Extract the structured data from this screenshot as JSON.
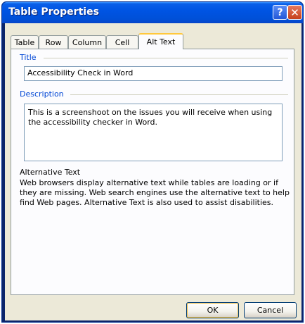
{
  "window": {
    "title": "Table Properties"
  },
  "titlebar": {
    "help_glyph": "?",
    "close_glyph": "✕"
  },
  "tabs": [
    {
      "label": "Table"
    },
    {
      "label": "Row"
    },
    {
      "label": "Column"
    },
    {
      "label": "Cell"
    },
    {
      "label": "Alt Text",
      "active": true
    }
  ],
  "alt_text": {
    "title_label": "Title",
    "title_value": "Accessibility Check in Word",
    "description_label": "Description",
    "description_value": "This is a screenshoot on the issues you will receive when using the accessibility checker in Word.",
    "info_heading": "Alternative Text",
    "info_body": "Web browsers display alternative text while tables are loading or if they are missing.  Web search engines use the alternative text to help find Web pages. Alternative Text is also used to assist disabilities."
  },
  "buttons": {
    "ok": "OK",
    "cancel": "Cancel"
  },
  "colors": {
    "titlebar": "#0054e3",
    "group_label": "#0046d5",
    "dialog_bg": "#ece9d8",
    "active_tab_accent": "#ffc83c"
  },
  "icons": {
    "help": "help-icon",
    "close": "close-icon"
  }
}
